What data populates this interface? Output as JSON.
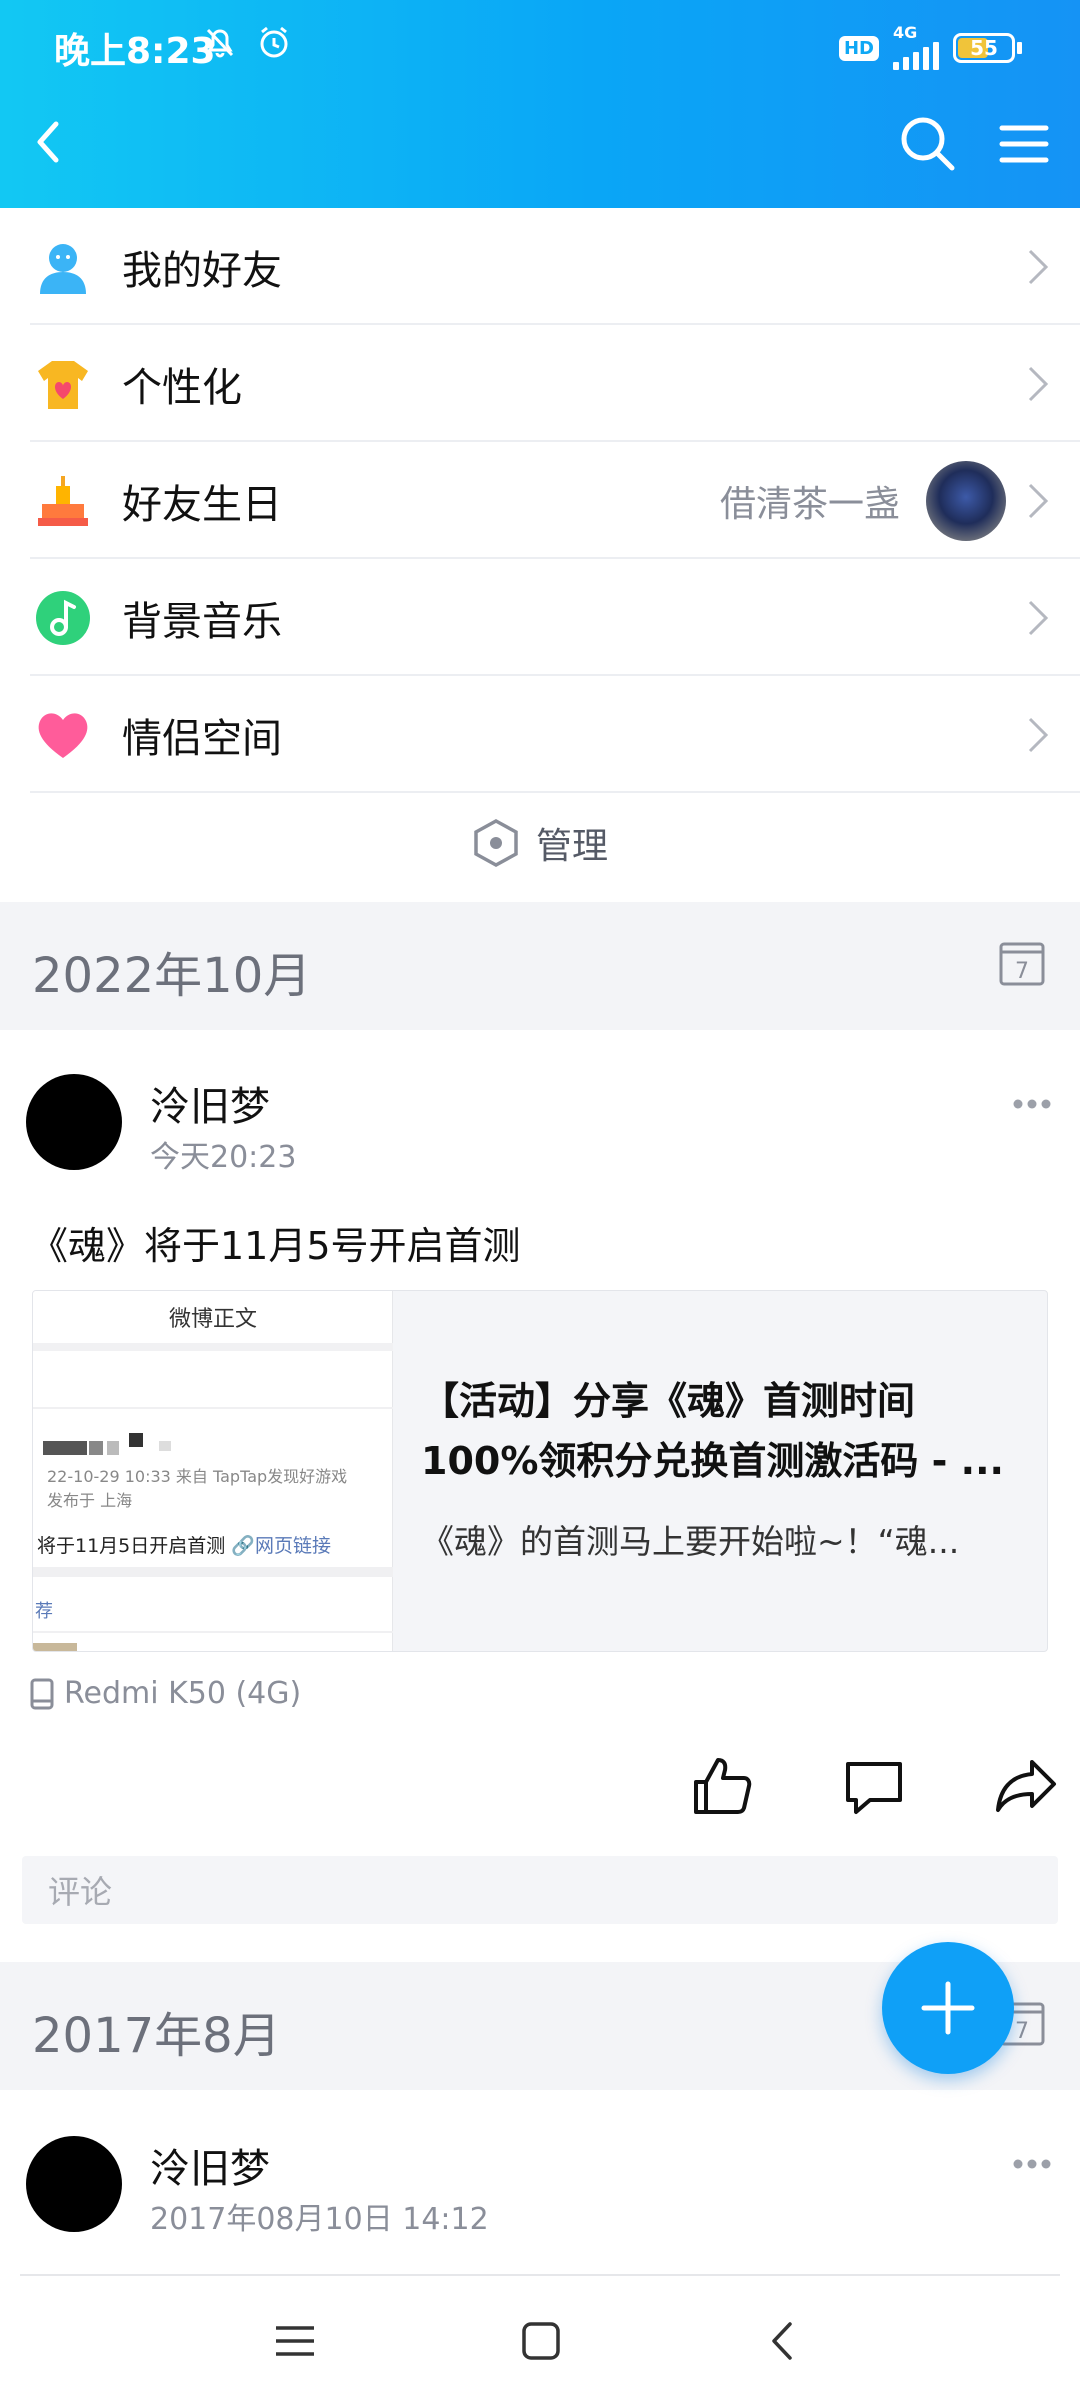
{
  "status_bar": {
    "time": "晚上8:23",
    "network_badge": "HD",
    "network_type": "4G",
    "battery": "55"
  },
  "menu": {
    "items": [
      {
        "label": "我的好友",
        "icon": "friends-icon"
      },
      {
        "label": "个性化",
        "icon": "personalize-icon"
      },
      {
        "label": "好友生日",
        "icon": "birthday-cake-icon",
        "friend_name": "借清茶一盏"
      },
      {
        "label": "背景音乐",
        "icon": "music-icon"
      },
      {
        "label": "情侣空间",
        "icon": "heart-icon"
      }
    ],
    "manage_label": "管理"
  },
  "sections": [
    {
      "date": "2022年10月",
      "post": {
        "author": "泠旧梦",
        "time": "今天20:23",
        "text": "《魂》将于11月5号开启首测",
        "share_card": {
          "thumb_header": "微博正文",
          "thumb_meta_1": "22-10-29 10:33  来自 TapTap发现好游戏",
          "thumb_meta_2": "发布于 上海",
          "thumb_caption": "将于11月5日开启首测",
          "thumb_link": "🔗网页链接",
          "thumb_tag": "荐",
          "title_line1": "【活动】分享《魂》首测时间",
          "title_line2": "100%领积分兑换首测激活码 - ...",
          "description": "《魂》的首测马上要开始啦~！“魂..."
        },
        "device": "Redmi K50 (4G)"
      },
      "comment_placeholder": "评论"
    },
    {
      "date": "2017年8月",
      "post": {
        "author": "泠旧梦",
        "time": "2017年08月10日 14:12"
      }
    }
  ],
  "colors": {
    "header_start": "#12c8f3",
    "header_end": "#1593f5",
    "accent": "#0fa0f7",
    "secondary_text": "#8a8e99"
  }
}
